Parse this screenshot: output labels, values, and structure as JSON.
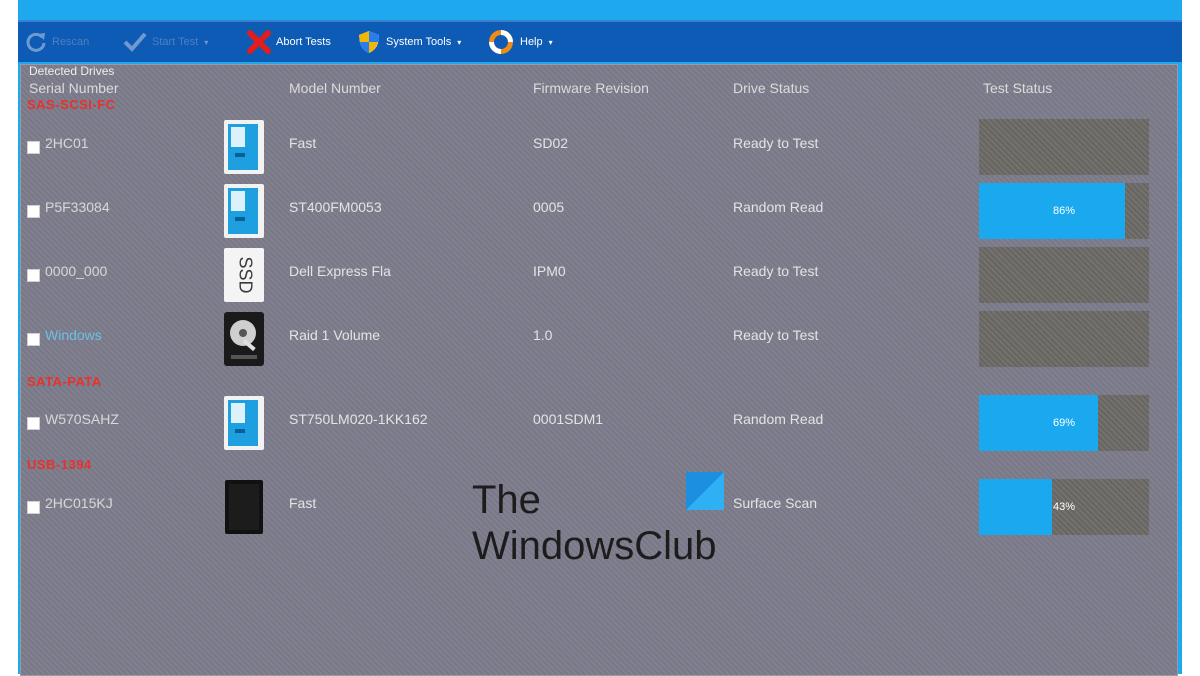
{
  "toolbar": {
    "items": [
      {
        "label": "Rescan",
        "icon": "refresh-icon",
        "enabled": false
      },
      {
        "label": "Start Test",
        "icon": "check-icon",
        "enabled": false
      },
      {
        "label": "Abort Tests",
        "icon": "abort-x-icon",
        "enabled": true
      },
      {
        "label": "System Tools",
        "icon": "shield-icon",
        "enabled": true
      },
      {
        "label": "Help",
        "icon": "lifebuoy-icon",
        "enabled": true
      }
    ]
  },
  "panel": {
    "title": "Detected Drives",
    "columns": {
      "serial": "Serial Number",
      "model": "Model Number",
      "firmware": "Firmware Revision",
      "drive_status": "Drive Status",
      "test_status": "Test Status"
    }
  },
  "groups": [
    {
      "label": "SAS-SCSI-FC",
      "drives": [
        {
          "serial": "2HC01",
          "icon": "drive-blue-icon",
          "model": "Fast",
          "firmware": "SD02",
          "status": "Ready to Test",
          "progress_pct": 0,
          "progress_text": ""
        },
        {
          "serial": "P5F33084",
          "icon": "drive-blue-icon",
          "model": "ST400FM0053",
          "firmware": "0005",
          "status": "Random Read",
          "progress_pct": 86,
          "progress_text": "86%"
        },
        {
          "serial": "0000_000",
          "icon": "ssd-icon",
          "model": "Dell Express Fla",
          "firmware": "IPM0",
          "status": "Ready to Test",
          "progress_pct": 0,
          "progress_text": ""
        },
        {
          "serial": "Windows",
          "icon": "hdd-platter-icon",
          "model": "Raid 1 Volume",
          "firmware": "1.0",
          "status": "Ready to Test",
          "progress_pct": 0,
          "progress_text": ""
        }
      ]
    },
    {
      "label": "SATA-PATA",
      "drives": [
        {
          "serial": "W570SAHZ",
          "icon": "drive-blue-icon",
          "model": "ST750LM020-1KK162",
          "firmware": "0001SDM1",
          "status": "Random Read",
          "progress_pct": 70,
          "progress_text": "69%"
        }
      ]
    },
    {
      "label": "USB-1394",
      "drives": [
        {
          "serial": "2HC015KJ",
          "icon": "usb-drive-black-icon",
          "model": "Fast",
          "firmware": "",
          "status": "Surface Scan",
          "progress_pct": 43,
          "progress_text": "43%"
        }
      ]
    }
  ],
  "watermark": {
    "line1": "The",
    "line2": "WindowsClub"
  },
  "colors": {
    "titlebar": "#1ea8ee",
    "toolbar": "#0d5bb5",
    "panel": "#7d7c8c",
    "progress_fill": "#1aa9ef",
    "progress_track": "#6d6a66",
    "group_label": "#e8312c"
  }
}
